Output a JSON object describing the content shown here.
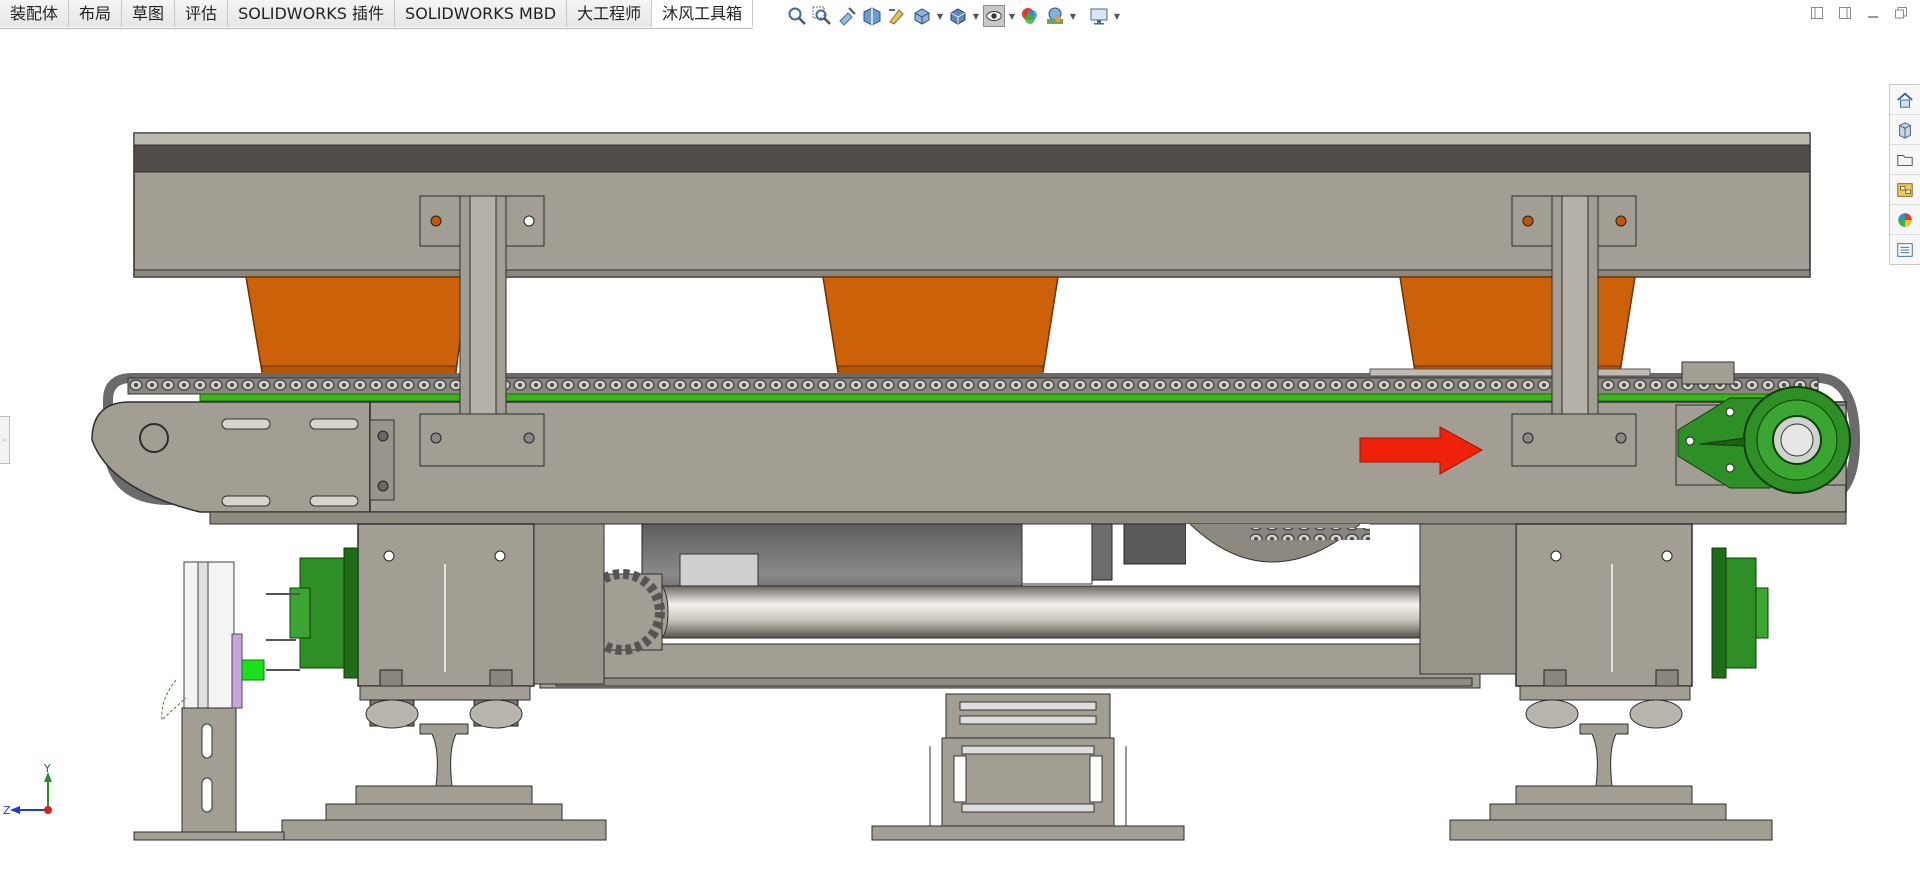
{
  "command_tabs": [
    {
      "label": "装配体",
      "active": false
    },
    {
      "label": "布局",
      "active": false
    },
    {
      "label": "草图",
      "active": false
    },
    {
      "label": "评估",
      "active": false
    },
    {
      "label": "SOLIDWORKS 插件",
      "active": false
    },
    {
      "label": "SOLIDWORKS MBD",
      "active": false
    },
    {
      "label": "大工程师",
      "active": false
    },
    {
      "label": "沐风工具箱",
      "active": true
    }
  ],
  "heads_up_toolbar": [
    {
      "icon": "zoom-to-fit-icon"
    },
    {
      "icon": "zoom-to-area-icon"
    },
    {
      "icon": "previous-view-icon"
    },
    {
      "icon": "section-view-icon"
    },
    {
      "icon": "dynamic-annotation-icon"
    },
    {
      "icon": "view-orientation-icon",
      "dropdown": true
    },
    {
      "icon": "display-style-icon",
      "dropdown": true
    },
    {
      "icon": "hide-show-items-icon",
      "dropdown": true,
      "pressed": true
    },
    {
      "icon": "edit-appearance-icon"
    },
    {
      "icon": "apply-scene-icon",
      "dropdown": true
    },
    {
      "icon": "view-settings-icon",
      "dropdown": true
    }
  ],
  "window_controls": [
    "tile-left-icon",
    "tile-right-icon",
    "minimize-icon",
    "restore-icon"
  ],
  "task_pane": [
    {
      "icon": "home-icon"
    },
    {
      "icon": "design-library-icon"
    },
    {
      "icon": "file-explorer-icon"
    },
    {
      "icon": "view-palette-icon"
    },
    {
      "icon": "appearances-icon"
    },
    {
      "icon": "custom-properties-icon"
    }
  ],
  "triad": {
    "y_label": "Y",
    "z_label": "Z"
  },
  "colors": {
    "frame": "#a39e94",
    "frame_dark": "#524d48",
    "bucket": "#cc6109",
    "belt": "#3eb21a",
    "sprocket_green": "#2d8f26",
    "flow_arrow": "#f0210a",
    "chain": "#6a6a6a"
  }
}
